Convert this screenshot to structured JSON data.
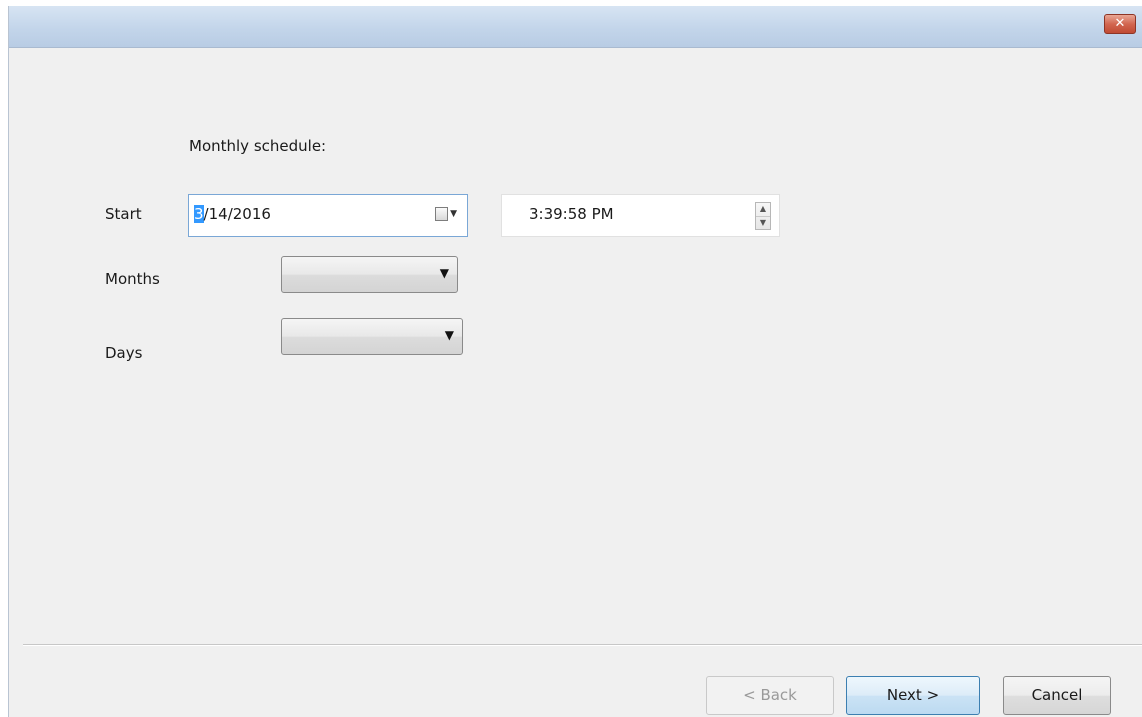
{
  "titlebar": {
    "close_glyph": "✕"
  },
  "schedule": {
    "heading": "Monthly schedule:",
    "start_label": "Start",
    "start_date_selected": "3",
    "start_date_rest": "/14/2016",
    "start_time": "3:39:58 PM",
    "months_label": "Months",
    "months_value": "",
    "days_label": "Days",
    "days_value": ""
  },
  "icons": {
    "calendar": "calendar-icon",
    "dropdown": "chevron-down-icon",
    "spin_up": "▲",
    "spin_down": "▼",
    "select_arrow": "▼",
    "cal_arrow": "▼"
  },
  "footer": {
    "back_label": "< Back",
    "next_label": "Next >",
    "cancel_label": "Cancel"
  },
  "colors": {
    "selection": "#3399ff",
    "next_border": "#3c7fb1",
    "close_button": "#c04a33"
  }
}
